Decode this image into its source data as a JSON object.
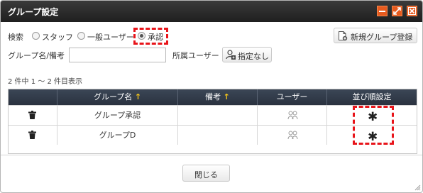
{
  "window": {
    "title": "グループ設定",
    "accent_color": "#e65a1e",
    "titlebar_color": "#2a2a2a"
  },
  "search": {
    "label": "検索",
    "options": [
      {
        "label": "スタッフ",
        "checked": false
      },
      {
        "label": "一般ユーザー",
        "checked": false
      },
      {
        "label": "承認",
        "checked": true
      }
    ],
    "name_label": "グループ名/備考",
    "name_value": "",
    "affiliation_label": "所属ユーザー",
    "affiliation_button": "指定なし"
  },
  "toolbar": {
    "new_group_label": "新規グループ登録"
  },
  "result_count": "2 件中 1 ～ 2 件目表示",
  "table": {
    "headers": {
      "name": "グループ名",
      "note": "備考",
      "users": "ユーザー",
      "order": "並び順設定"
    },
    "sort_arrow": "↑",
    "rows": [
      {
        "name": "グループ承認",
        "note": ""
      },
      {
        "name": "グループD",
        "note": ""
      }
    ]
  },
  "footer": {
    "close_label": "閉じる"
  },
  "annotation_color": "#e8141a"
}
